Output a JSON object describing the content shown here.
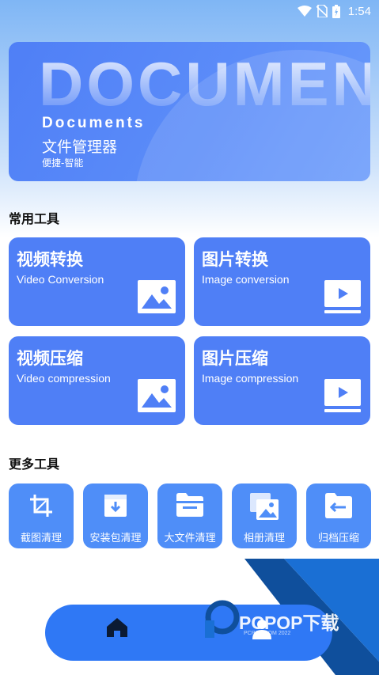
{
  "status_bar": {
    "time": "1:54",
    "icons": [
      "wifi-icon",
      "no-sim-icon",
      "battery-icon"
    ]
  },
  "banner": {
    "background_word": "DOCUMENTS",
    "title": "Documents",
    "subtitle": "文件管理器",
    "tagline": "便捷-智能"
  },
  "common_tools": {
    "heading": "常用工具",
    "cards": [
      {
        "title": "视频转换",
        "subtitle": "Video Conversion",
        "icon": "image-icon"
      },
      {
        "title": "图片转换",
        "subtitle": "Image conversion",
        "icon": "video-play-icon"
      },
      {
        "title": "视频压缩",
        "subtitle": "Video compression",
        "icon": "image-icon"
      },
      {
        "title": "图片压缩",
        "subtitle": "Image compression",
        "icon": "video-play-icon"
      }
    ]
  },
  "more_tools": {
    "heading": "更多工具",
    "items": [
      {
        "label": "截图清理",
        "icon": "crop-icon"
      },
      {
        "label": "安装包清理",
        "icon": "package-download-icon"
      },
      {
        "label": "大文件清理",
        "icon": "folder-icon"
      },
      {
        "label": "相册清理",
        "icon": "album-icon"
      },
      {
        "label": "归档压缩",
        "icon": "archive-folder-icon"
      }
    ]
  },
  "watermark": {
    "text": "PCPOP下载",
    "subtext": "PCPOP.COM 2022"
  },
  "bottom_nav": {
    "items": [
      "home-icon",
      "user-icon"
    ]
  },
  "colors": {
    "accent": "#4f7ff6",
    "tool_bg": "#4f8ef8",
    "nav_bg": "#2f78f5",
    "watermark": "#0f4f9c"
  }
}
